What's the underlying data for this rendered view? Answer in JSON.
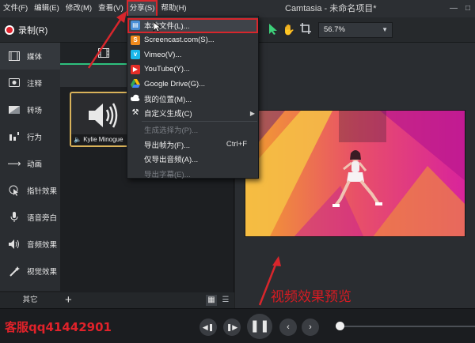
{
  "menubar": {
    "items": [
      "文件(F)",
      "编辑(E)",
      "修改(M)",
      "查看(V)",
      "分享(S)",
      "帮助(H)"
    ],
    "window_title": "Camtasia - 未命名项目*"
  },
  "toolbar": {
    "record_label": "录制(R)",
    "zoom_value": "56.7%"
  },
  "leftnav": {
    "items": [
      "媒体",
      "注释",
      "转场",
      "行为",
      "动画",
      "指针效果",
      "语音旁白",
      "音频效果",
      "视觉效果"
    ],
    "more_label": "其它"
  },
  "bin": {
    "media_caption": "Kylie Minogue"
  },
  "share_menu": {
    "items": [
      {
        "label": "本地文件(L)...",
        "icon": "local-file-icon",
        "color": "#4a8fd6"
      },
      {
        "label": "Screencast.com(S)...",
        "icon": "screencast-icon",
        "color": "#f08a1c"
      },
      {
        "label": "Vimeo(V)...",
        "icon": "vimeo-icon",
        "color": "#1ab7ea"
      },
      {
        "label": "YouTube(Y)...",
        "icon": "youtube-icon",
        "color": "#e52d27"
      },
      {
        "label": "Google Drive(G)...",
        "icon": "google-drive-icon",
        "color": "#34a853"
      },
      {
        "label": "我的位置(M)...",
        "icon": "cloud-icon",
        "color": "#ffffff"
      },
      {
        "label": "自定义生成(C)",
        "icon": "tools-icon",
        "color": "#ffffff"
      },
      {
        "label": "生成选择为(P)..."
      },
      {
        "label": "导出帧为(F)...",
        "shortcut": "Ctrl+F"
      },
      {
        "label": "仅导出音频(A)..."
      },
      {
        "label": "导出字幕(E)..."
      }
    ]
  },
  "preview": {
    "annotation": "视频效果预览"
  },
  "watermark": "客服qq41442901",
  "colors": {
    "accent_red": "#d8262c",
    "accent_green": "#2ec07d",
    "tile_border": "#d9b25a"
  }
}
